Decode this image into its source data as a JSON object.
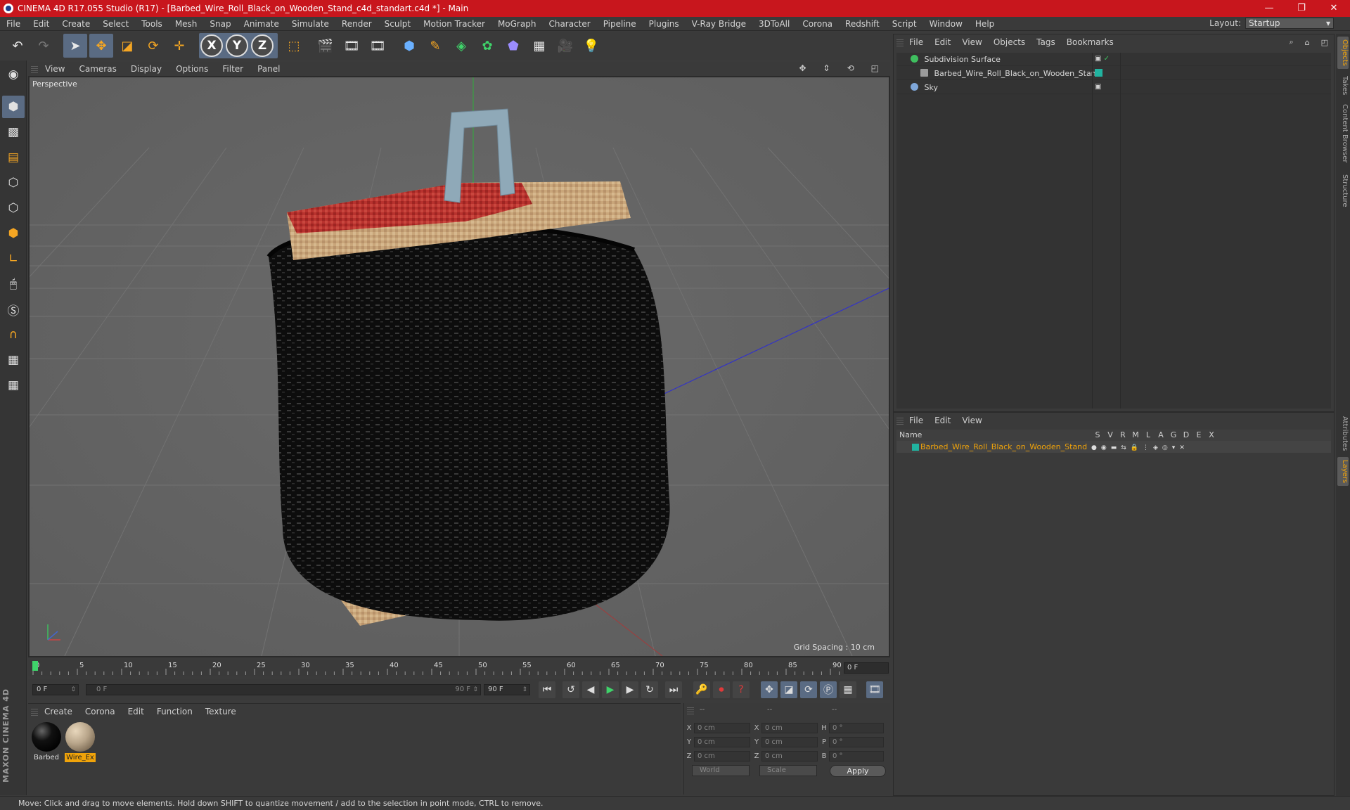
{
  "window": {
    "title": "CINEMA 4D R17.055 Studio (R17) - [Barbed_Wire_Roll_Black_on_Wooden_Stand_c4d_standart.c4d *] - Main",
    "controls": [
      "—",
      "❐",
      "✕"
    ]
  },
  "menu": [
    "File",
    "Edit",
    "Create",
    "Select",
    "Tools",
    "Mesh",
    "Snap",
    "Animate",
    "Simulate",
    "Render",
    "Sculpt",
    "Motion Tracker",
    "MoGraph",
    "Character",
    "Pipeline",
    "Plugins",
    "V-Ray Bridge",
    "3DToAll",
    "Corona",
    "Redshift",
    "Script",
    "Window",
    "Help"
  ],
  "layout": {
    "label": "Layout:",
    "value": "Startup"
  },
  "toolbar": {
    "axes": [
      "X",
      "Y",
      "Z"
    ]
  },
  "viewport": {
    "menu": [
      "View",
      "Cameras",
      "Display",
      "Options",
      "Filter",
      "Panel"
    ],
    "label": "Perspective",
    "grid_spacing": "Grid Spacing : 10 cm"
  },
  "timeline": {
    "ticks": [
      "0",
      "5",
      "10",
      "15",
      "20",
      "25",
      "30",
      "35",
      "40",
      "45",
      "50",
      "55",
      "60",
      "65",
      "70",
      "75",
      "80",
      "85",
      "90"
    ],
    "current": "0 F"
  },
  "transport": {
    "start": "0 F",
    "range_start": "0 F",
    "range_end": "90 F",
    "end": "90 F"
  },
  "materials": {
    "menu": [
      "Create",
      "Corona",
      "Edit",
      "Function",
      "Texture"
    ],
    "items": [
      {
        "name": "Barbed",
        "color": "#111111"
      },
      {
        "name": "Wire_Ex",
        "color": "#b8a58a"
      }
    ]
  },
  "coords": {
    "header": [
      "--",
      "--",
      "--"
    ],
    "rows": [
      {
        "a": "X",
        "av": "0 cm",
        "b": "X",
        "bv": "0 cm",
        "c": "H",
        "cv": "0 °"
      },
      {
        "a": "Y",
        "av": "0 cm",
        "b": "Y",
        "bv": "0 cm",
        "c": "P",
        "cv": "0 °"
      },
      {
        "a": "Z",
        "av": "0 cm",
        "b": "Z",
        "bv": "0 cm",
        "c": "B",
        "cv": "0 °"
      }
    ],
    "world": "World",
    "scale": "Scale",
    "apply": "Apply"
  },
  "objects": {
    "menu": [
      "File",
      "Edit",
      "View",
      "Objects",
      "Tags",
      "Bookmarks"
    ],
    "items": [
      {
        "name": "Subdivision Surface",
        "color": "#3fbf5f"
      },
      {
        "name": "Barbed_Wire_Roll_Black_on_Wooden_Stand",
        "color": "#9a9a9a"
      },
      {
        "name": "Sky",
        "color": "#7fa7d9"
      }
    ]
  },
  "layers": {
    "menu": [
      "File",
      "Edit",
      "View"
    ],
    "header_name": "Name",
    "columns": [
      "S",
      "V",
      "R",
      "M",
      "L",
      "A",
      "G",
      "D",
      "E",
      "X"
    ],
    "row": "Barbed_Wire_Roll_Black_on_Wooden_Stand",
    "row_color": "#21b3a0"
  },
  "right_tabs": [
    "Objects",
    "Takes",
    "Content Browser",
    "Structure",
    "Attributes",
    "Layers"
  ],
  "status": "Move: Click and drag to move elements. Hold down SHIFT to quantize movement / add to the selection in point mode, CTRL to remove.",
  "brand": "MAXON CINEMA 4D"
}
